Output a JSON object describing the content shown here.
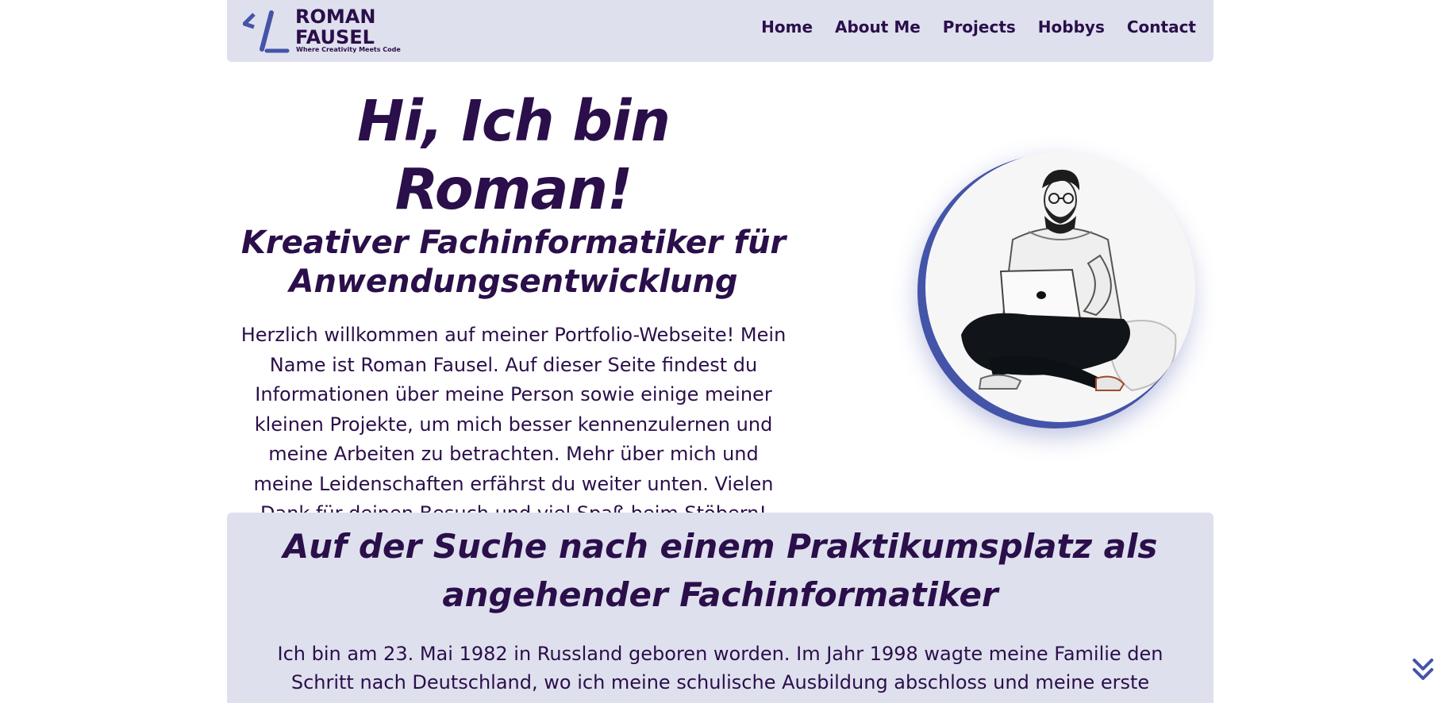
{
  "header": {
    "logo_line1": "ROMAN",
    "logo_line2": "FAUSEL",
    "logo_tagline": "Where Creativity Meets Code",
    "nav": [
      "Home",
      "About Me",
      "Projects",
      "Hobbys",
      "Contact"
    ]
  },
  "hero": {
    "title": "Hi, Ich bin Roman!",
    "subtitle": "Kreativer Fachinformatiker für Anwendungsentwicklung",
    "intro": "Herzlich willkommen auf meiner Portfolio-Webseite! Mein Name ist Roman Fausel. Auf dieser Seite findest du Informationen über meine Person sowie einige meiner kleinen Projekte, um mich besser kennenzulernen und meine Arbeiten zu betrachten. Mehr über mich und meine Leidenschaften erfährst du weiter unten. Vielen Dank für deinen Besuch und viel Spaß beim Stöbern!"
  },
  "about": {
    "title": "Auf der Suche nach einem Praktikumsplatz als angehender Fachinformatiker",
    "text": "Ich bin am 23. Mai 1982 in Russland geboren worden. Im Jahr 1998 wagte meine Familie den Schritt nach Deutschland, wo ich meine schulische Ausbildung abschloss und meine erste"
  },
  "icons": {
    "logo": "code-slash-icon",
    "scroll": "double-chevron-down-icon",
    "portrait": "developer-illustration"
  },
  "colors": {
    "primary_text": "#2a0f4a",
    "accent": "#4454a8",
    "panel_background": "#dfe0ee"
  }
}
